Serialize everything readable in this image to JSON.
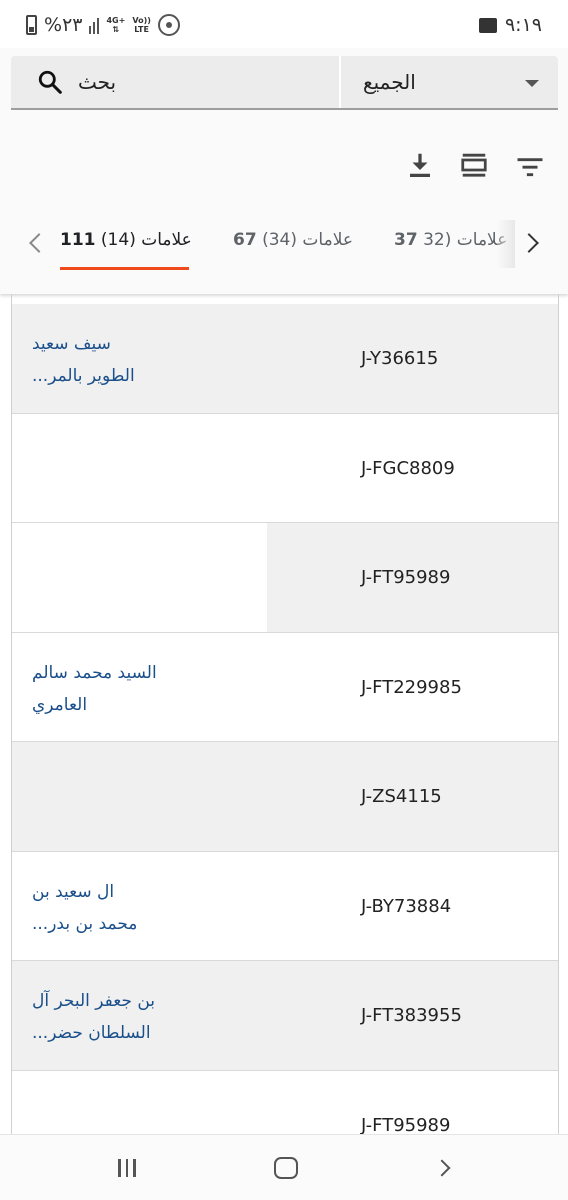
{
  "status_bar": {
    "battery": "%٢٣",
    "network": "4G+",
    "volte_top": "Vo))",
    "volte_bottom": "LTE",
    "time": "٩:١٩"
  },
  "search_bar": {
    "filter_value": "الجميع",
    "search_label": "بحث"
  },
  "tabs": [
    {
      "count": "(14)",
      "label": "علامات",
      "number": "111",
      "active": true
    },
    {
      "count": "(34)",
      "label": "علامات",
      "number": "67",
      "active": false
    },
    {
      "count": "(32",
      "label": "علامات",
      "number": "37",
      "active": false
    }
  ],
  "rows": [
    {
      "name_line1": "سيف سعيد",
      "name_line2": "...الطوير بالمر",
      "code": "J-Y36615"
    },
    {
      "name_line1": "",
      "name_line2": "",
      "code": "J-FGC8809"
    },
    {
      "name_line1": "",
      "name_line2": "",
      "code": "J-FT95989"
    },
    {
      "name_line1": "السيد محمد سالم",
      "name_line2": "العامري",
      "code": "J-FT229985"
    },
    {
      "name_line1": "",
      "name_line2": "",
      "code": "J-ZS4115"
    },
    {
      "name_line1": "ال سعيد بن",
      "name_line2": "...محمد بن بدر",
      "code": "J-BY73884"
    },
    {
      "name_line1": "بن جعفر البحر آل",
      "name_line2": "...السلطان حضر",
      "code": "J-FT383955"
    },
    {
      "name_line1": "",
      "name_line2": "",
      "code": "J-FT95989"
    }
  ],
  "colors": {
    "accent": "#ee4a1b",
    "link": "#1a4f8b",
    "row_grey": "#f0f0f0"
  }
}
